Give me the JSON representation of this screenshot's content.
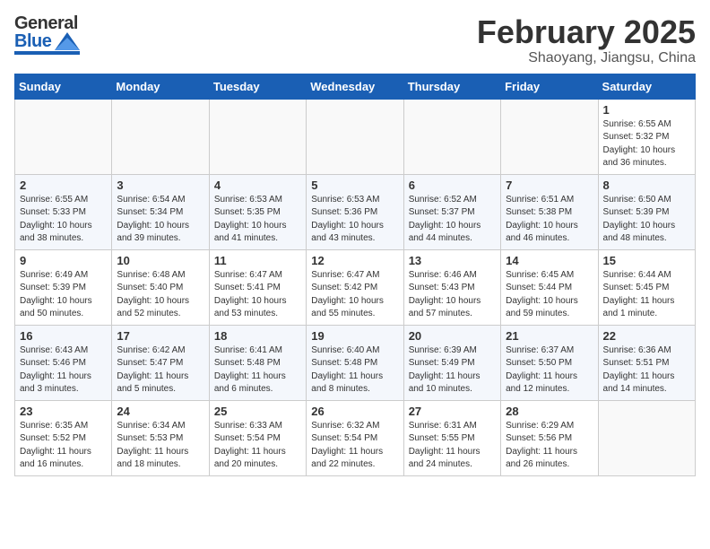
{
  "header": {
    "logo_general": "General",
    "logo_blue": "Blue",
    "month_title": "February 2025",
    "location": "Shaoyang, Jiangsu, China"
  },
  "weekdays": [
    "Sunday",
    "Monday",
    "Tuesday",
    "Wednesday",
    "Thursday",
    "Friday",
    "Saturday"
  ],
  "weeks": [
    [
      {
        "day": "",
        "info": ""
      },
      {
        "day": "",
        "info": ""
      },
      {
        "day": "",
        "info": ""
      },
      {
        "day": "",
        "info": ""
      },
      {
        "day": "",
        "info": ""
      },
      {
        "day": "",
        "info": ""
      },
      {
        "day": "1",
        "info": "Sunrise: 6:55 AM\nSunset: 5:32 PM\nDaylight: 10 hours\nand 36 minutes."
      }
    ],
    [
      {
        "day": "2",
        "info": "Sunrise: 6:55 AM\nSunset: 5:33 PM\nDaylight: 10 hours\nand 38 minutes."
      },
      {
        "day": "3",
        "info": "Sunrise: 6:54 AM\nSunset: 5:34 PM\nDaylight: 10 hours\nand 39 minutes."
      },
      {
        "day": "4",
        "info": "Sunrise: 6:53 AM\nSunset: 5:35 PM\nDaylight: 10 hours\nand 41 minutes."
      },
      {
        "day": "5",
        "info": "Sunrise: 6:53 AM\nSunset: 5:36 PM\nDaylight: 10 hours\nand 43 minutes."
      },
      {
        "day": "6",
        "info": "Sunrise: 6:52 AM\nSunset: 5:37 PM\nDaylight: 10 hours\nand 44 minutes."
      },
      {
        "day": "7",
        "info": "Sunrise: 6:51 AM\nSunset: 5:38 PM\nDaylight: 10 hours\nand 46 minutes."
      },
      {
        "day": "8",
        "info": "Sunrise: 6:50 AM\nSunset: 5:39 PM\nDaylight: 10 hours\nand 48 minutes."
      }
    ],
    [
      {
        "day": "9",
        "info": "Sunrise: 6:49 AM\nSunset: 5:39 PM\nDaylight: 10 hours\nand 50 minutes."
      },
      {
        "day": "10",
        "info": "Sunrise: 6:48 AM\nSunset: 5:40 PM\nDaylight: 10 hours\nand 52 minutes."
      },
      {
        "day": "11",
        "info": "Sunrise: 6:47 AM\nSunset: 5:41 PM\nDaylight: 10 hours\nand 53 minutes."
      },
      {
        "day": "12",
        "info": "Sunrise: 6:47 AM\nSunset: 5:42 PM\nDaylight: 10 hours\nand 55 minutes."
      },
      {
        "day": "13",
        "info": "Sunrise: 6:46 AM\nSunset: 5:43 PM\nDaylight: 10 hours\nand 57 minutes."
      },
      {
        "day": "14",
        "info": "Sunrise: 6:45 AM\nSunset: 5:44 PM\nDaylight: 10 hours\nand 59 minutes."
      },
      {
        "day": "15",
        "info": "Sunrise: 6:44 AM\nSunset: 5:45 PM\nDaylight: 11 hours\nand 1 minute."
      }
    ],
    [
      {
        "day": "16",
        "info": "Sunrise: 6:43 AM\nSunset: 5:46 PM\nDaylight: 11 hours\nand 3 minutes."
      },
      {
        "day": "17",
        "info": "Sunrise: 6:42 AM\nSunset: 5:47 PM\nDaylight: 11 hours\nand 5 minutes."
      },
      {
        "day": "18",
        "info": "Sunrise: 6:41 AM\nSunset: 5:48 PM\nDaylight: 11 hours\nand 6 minutes."
      },
      {
        "day": "19",
        "info": "Sunrise: 6:40 AM\nSunset: 5:48 PM\nDaylight: 11 hours\nand 8 minutes."
      },
      {
        "day": "20",
        "info": "Sunrise: 6:39 AM\nSunset: 5:49 PM\nDaylight: 11 hours\nand 10 minutes."
      },
      {
        "day": "21",
        "info": "Sunrise: 6:37 AM\nSunset: 5:50 PM\nDaylight: 11 hours\nand 12 minutes."
      },
      {
        "day": "22",
        "info": "Sunrise: 6:36 AM\nSunset: 5:51 PM\nDaylight: 11 hours\nand 14 minutes."
      }
    ],
    [
      {
        "day": "23",
        "info": "Sunrise: 6:35 AM\nSunset: 5:52 PM\nDaylight: 11 hours\nand 16 minutes."
      },
      {
        "day": "24",
        "info": "Sunrise: 6:34 AM\nSunset: 5:53 PM\nDaylight: 11 hours\nand 18 minutes."
      },
      {
        "day": "25",
        "info": "Sunrise: 6:33 AM\nSunset: 5:54 PM\nDaylight: 11 hours\nand 20 minutes."
      },
      {
        "day": "26",
        "info": "Sunrise: 6:32 AM\nSunset: 5:54 PM\nDaylight: 11 hours\nand 22 minutes."
      },
      {
        "day": "27",
        "info": "Sunrise: 6:31 AM\nSunset: 5:55 PM\nDaylight: 11 hours\nand 24 minutes."
      },
      {
        "day": "28",
        "info": "Sunrise: 6:29 AM\nSunset: 5:56 PM\nDaylight: 11 hours\nand 26 minutes."
      },
      {
        "day": "",
        "info": ""
      }
    ]
  ]
}
